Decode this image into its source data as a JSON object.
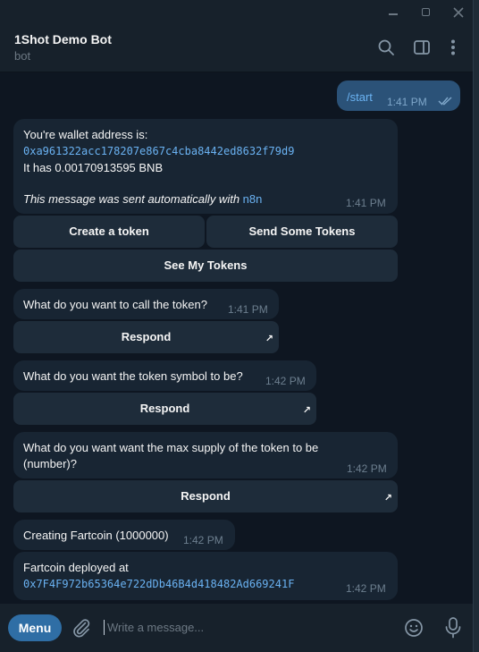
{
  "chat": {
    "name": "1Shot Demo Bot",
    "status": "bot"
  },
  "messages": {
    "start": {
      "text": "/start",
      "time": "1:41 PM"
    },
    "wallet": {
      "line1": "You're wallet address is:",
      "address": "0xa961322acc178207e867c4cba8442ed8632f79d9",
      "balance": "It has 0.00170913595 BNB",
      "auto_prefix": "This message was sent automatically with ",
      "auto_link": "n8n",
      "time": "1:41 PM"
    },
    "keyboard": {
      "create": "Create a token",
      "send": "Send Some Tokens",
      "see": "See My Tokens"
    },
    "q_name": {
      "text": "What do you want to call the token?",
      "time": "1:41 PM",
      "button": "Respond"
    },
    "q_symbol": {
      "text": "What do you want the token symbol to be?",
      "time": "1:42 PM",
      "button": "Respond"
    },
    "q_supply": {
      "text_line1": "What do you want want the max supply of the token to be",
      "text_line2": "(number)?",
      "time": "1:42 PM",
      "button": "Respond"
    },
    "creating": {
      "text": "Creating Fartcoin (1000000)",
      "time": "1:42 PM"
    },
    "deployed": {
      "text": "Fartcoin deployed at",
      "address": "0x7F4F972b65364e722dDb46B4d418482Ad669241F",
      "time": "1:42 PM"
    }
  },
  "composer": {
    "menu_label": "Menu",
    "placeholder": "Write a message..."
  },
  "icons": {
    "window": [
      "minimize-icon",
      "maximize-icon",
      "close-icon"
    ],
    "header": [
      "search-icon",
      "sidebar-toggle-icon",
      "more-vertical-icon"
    ],
    "composer": [
      "attach-icon",
      "emoji-icon",
      "microphone-icon"
    ],
    "message": [
      "double-check-icon",
      "open-arrow-icon"
    ]
  },
  "colors": {
    "accent": "#2f6ea5",
    "outgoing_bubble": "#2b5278",
    "incoming_bubble": "#182533",
    "link": "#6ab2f2",
    "background": "#0e1621"
  }
}
